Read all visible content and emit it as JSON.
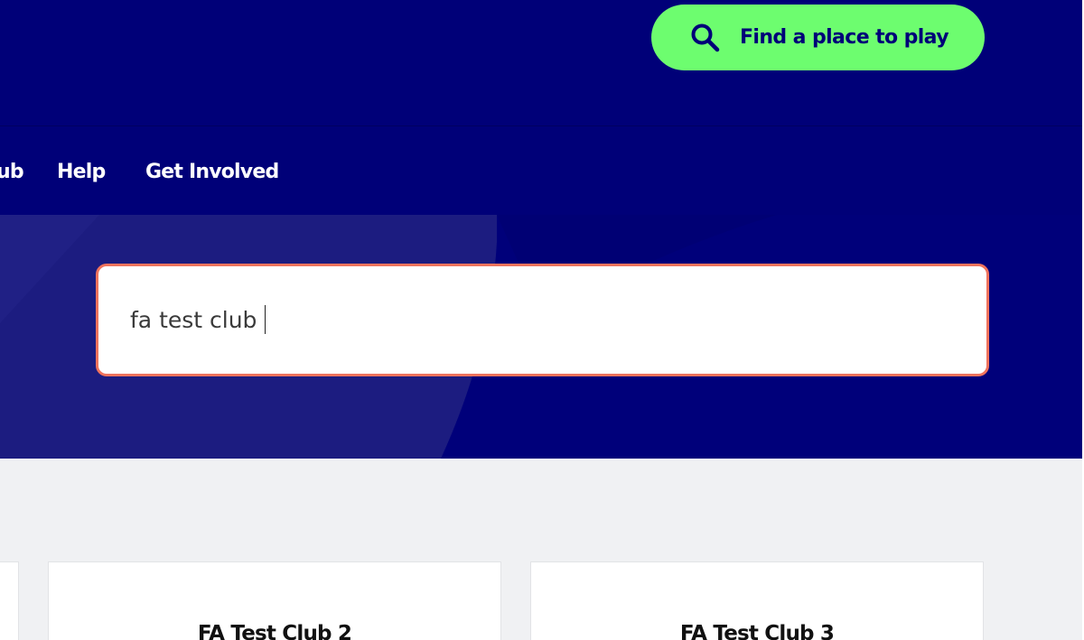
{
  "header": {
    "find_button_label": "Find a place to play",
    "find_button_icon": "search-icon"
  },
  "nav": {
    "items": [
      {
        "label": "ub"
      },
      {
        "label": "Help"
      },
      {
        "label": "Get Involved"
      }
    ]
  },
  "search": {
    "value": "fa test club"
  },
  "results": {
    "cards": [
      {
        "title": ""
      },
      {
        "title": "FA Test Club 2"
      },
      {
        "title": "FA Test Club 3"
      }
    ]
  },
  "colors": {
    "brand_navy": "#000078",
    "accent_green": "#6dfd6f",
    "focus_outline": "#f0735d",
    "page_background": "#f0f1f3"
  }
}
